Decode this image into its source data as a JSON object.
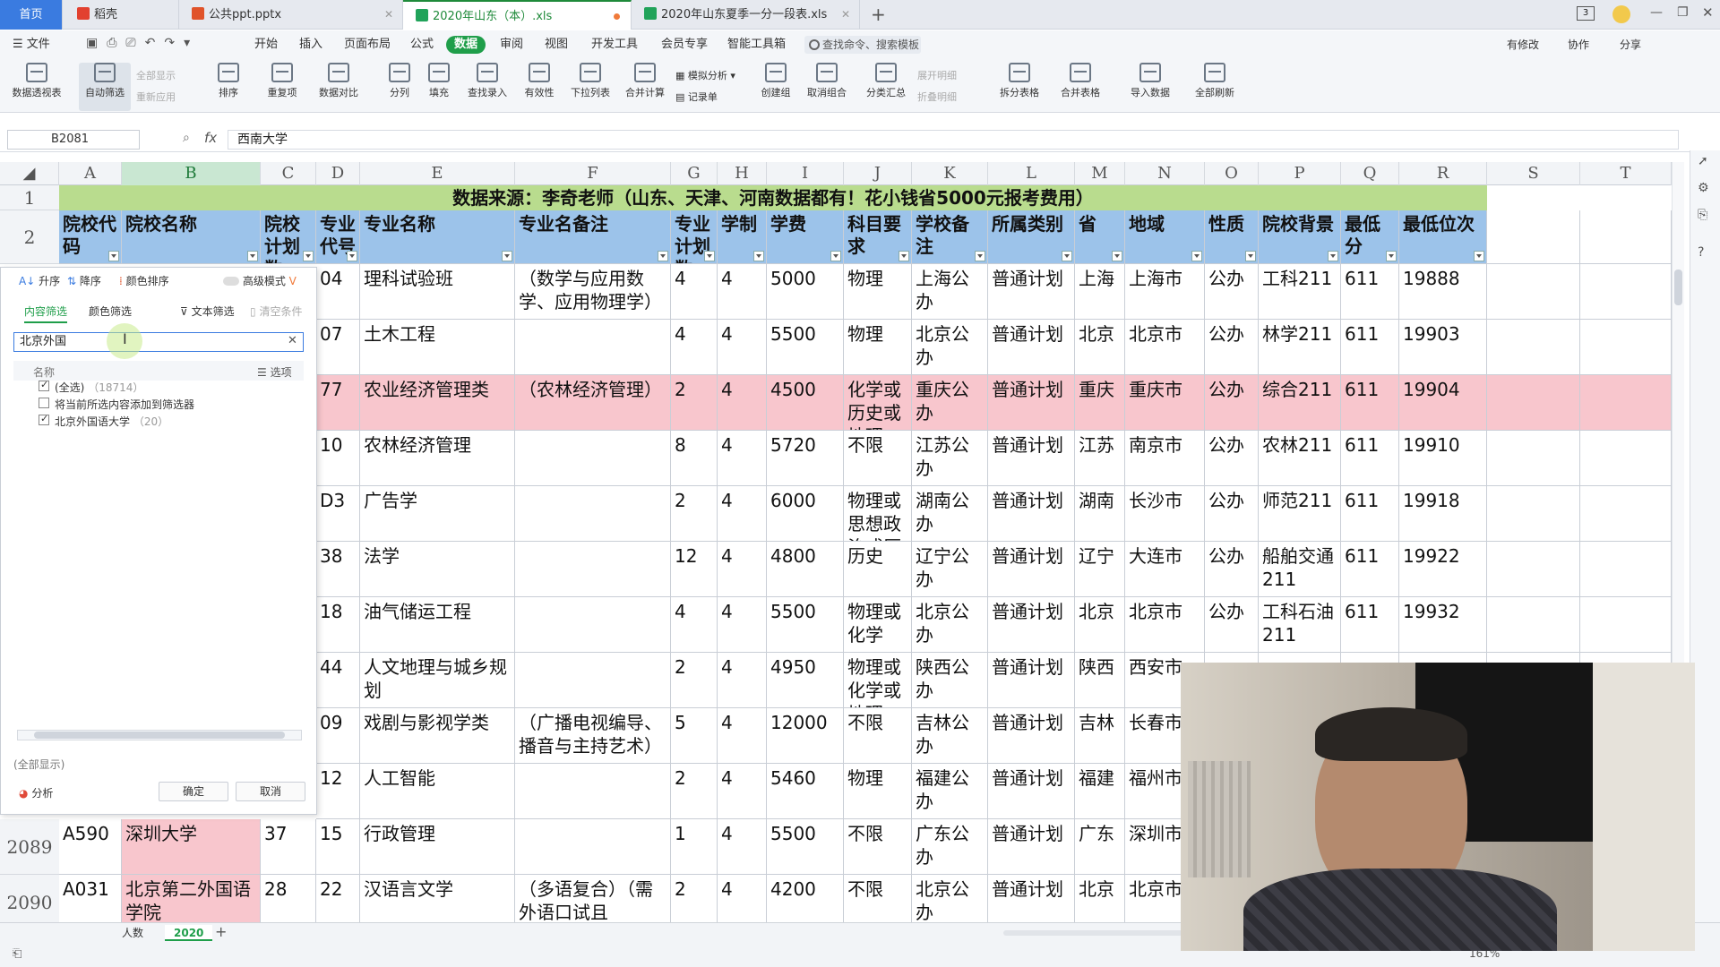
{
  "tabs": [
    {
      "label": "首页"
    },
    {
      "label": "稻壳"
    },
    {
      "label": "公共ppt.pptx"
    },
    {
      "label": "2020年山东（本）.xls"
    },
    {
      "label": "2020年山东夏季一分一段表.xls"
    }
  ],
  "menu": {
    "file": "文件",
    "items": [
      "开始",
      "插入",
      "页面布局",
      "公式",
      "数据",
      "审阅",
      "视图",
      "开发工具",
      "会员专享",
      "智能工具箱"
    ],
    "search": "查找命令、搜索模板",
    "right": [
      "有修改",
      "协作",
      "分享"
    ]
  },
  "ribbon": {
    "big": [
      "数据透视表",
      "自动筛选",
      "排序",
      "重复项",
      "数据对比",
      "分列",
      "填充",
      "查找录入",
      "有效性",
      "下拉列表",
      "合并计算",
      "创建组",
      "取消组合",
      "分类汇总",
      "拆分表格",
      "合并表格",
      "导入数据",
      "全部刷新"
    ],
    "small": [
      "全部显示",
      "重新应用",
      "模拟分析",
      "记录单",
      "展开明细",
      "折叠明细"
    ]
  },
  "formula": {
    "cell_ref": "B2081",
    "fx": "fx",
    "content": "西南大学"
  },
  "columns": [
    "A",
    "B",
    "C",
    "D",
    "E",
    "F",
    "G",
    "H",
    "I",
    "J",
    "K",
    "L",
    "M",
    "N",
    "O",
    "P",
    "Q",
    "R",
    "S",
    "T"
  ],
  "title_row": "数据来源：李奇老师（山东、天津、河南数据都有！花小钱省5000元报考费用）",
  "headers": [
    "院校代码",
    "院校名称",
    "院校计划数",
    "专业代号",
    "专业名称",
    "专业名备注",
    "专业计划数",
    "学制",
    "学费",
    "科目要求",
    "学校备注",
    "所属类别",
    "省",
    "地域",
    "性质",
    "院校背景",
    "最低分",
    "最低位次"
  ],
  "rows": [
    {
      "d": "04",
      "e": "理科试验班",
      "f": "（数学与应用数学、应用物理学）",
      "g": "4",
      "h": "4",
      "i": "5000",
      "j": "物理",
      "k": "上海公办",
      "l": "普通计划",
      "m": "上海",
      "n": "上海市",
      "o": "公办",
      "p": "工科211",
      "q": "611",
      "r": "19888"
    },
    {
      "d": "07",
      "e": "土木工程",
      "f": "",
      "g": "4",
      "h": "4",
      "i": "5500",
      "j": "物理",
      "k": "北京公办",
      "l": "普通计划",
      "m": "北京",
      "n": "北京市",
      "o": "公办",
      "p": "林学211",
      "q": "611",
      "r": "19903"
    },
    {
      "d": "77",
      "e": "农业经济管理类",
      "f": "（农林经济管理）",
      "g": "2",
      "h": "4",
      "i": "4500",
      "j": "化学或历史或地理",
      "k": "重庆公办",
      "l": "普通计划",
      "m": "重庆",
      "n": "重庆市",
      "o": "公办",
      "p": "综合211",
      "q": "611",
      "r": "19904"
    },
    {
      "d": "10",
      "e": "农林经济管理",
      "f": "",
      "g": "8",
      "h": "4",
      "i": "5720",
      "j": "不限",
      "k": "江苏公办",
      "l": "普通计划",
      "m": "江苏",
      "n": "南京市",
      "o": "公办",
      "p": "农林211",
      "q": "611",
      "r": "19910"
    },
    {
      "d": "D3",
      "e": "广告学",
      "f": "",
      "g": "2",
      "h": "4",
      "i": "6000",
      "j": "物理或思想政治或历史",
      "k": "湖南公办",
      "l": "普通计划",
      "m": "湖南",
      "n": "长沙市",
      "o": "公办",
      "p": "师范211",
      "q": "611",
      "r": "19918"
    },
    {
      "d": "38",
      "e": "法学",
      "f": "",
      "g": "12",
      "h": "4",
      "i": "4800",
      "j": "历史",
      "k": "辽宁公办",
      "l": "普通计划",
      "m": "辽宁",
      "n": "大连市",
      "o": "公办",
      "p": "船舶交通211",
      "q": "611",
      "r": "19922"
    },
    {
      "d": "18",
      "e": "油气储运工程",
      "f": "",
      "g": "4",
      "h": "4",
      "i": "5500",
      "j": "物理或化学",
      "k": "北京公办",
      "l": "普通计划",
      "m": "北京",
      "n": "北京市",
      "o": "公办",
      "p": "工科石油211",
      "q": "611",
      "r": "19932"
    },
    {
      "d": "44",
      "e": "人文地理与城乡规划",
      "f": "",
      "g": "2",
      "h": "4",
      "i": "4950",
      "j": "物理或化学或地理",
      "k": "陕西公办",
      "l": "普通计划",
      "m": "陕西",
      "n": "西安市",
      "o": "",
      "p": "",
      "q": "",
      "r": ""
    },
    {
      "d": "09",
      "e": "戏剧与影视学类",
      "f": "（广播电视编导、播音与主持艺术）",
      "g": "5",
      "h": "4",
      "i": "12000",
      "j": "不限",
      "k": "吉林公办",
      "l": "普通计划",
      "m": "吉林",
      "n": "长春市",
      "o": "",
      "p": "",
      "q": "",
      "r": ""
    },
    {
      "d": "12",
      "e": "人工智能",
      "f": "",
      "g": "2",
      "h": "4",
      "i": "5460",
      "j": "物理",
      "k": "福建公办",
      "l": "普通计划",
      "m": "福建",
      "n": "福州市",
      "o": "",
      "p": "",
      "q": "",
      "r": ""
    },
    {
      "rownum": "2089",
      "a": "A590",
      "b": "深圳大学",
      "c": "37",
      "d": "15",
      "e": "行政管理",
      "f": "",
      "g": "1",
      "h": "4",
      "i": "5500",
      "j": "不限",
      "k": "广东公办",
      "l": "普通计划",
      "m": "广东",
      "n": "深圳市",
      "o": "",
      "p": "",
      "q": "",
      "r": ""
    },
    {
      "rownum": "2090",
      "a": "A031",
      "b": "北京第二外国语学院",
      "c": "28",
      "d": "22",
      "e": "汉语言文学",
      "f": "（多语复合）（需外语口试且",
      "g": "2",
      "h": "4",
      "i": "4200",
      "j": "不限",
      "k": "北京公办",
      "l": "普通计划",
      "m": "北京",
      "n": "北京市",
      "o": "",
      "p": "",
      "q": "",
      "r": ""
    }
  ],
  "filter_panel": {
    "sort_asc": "升序",
    "sort_desc": "降序",
    "sort_color": "颜色排序",
    "advanced": "高级模式",
    "tab_content": "内容筛选",
    "tab_color": "颜色筛选",
    "tab_text": "文本筛选",
    "tab_clear": "清空条件",
    "search_value": "北京外国",
    "list_header": "名称",
    "options": "选项",
    "items": [
      {
        "label": "(全选)",
        "count": "（18714）",
        "checked": true
      },
      {
        "label": "将当前所选内容添加到筛选器",
        "count": "",
        "checked": false
      },
      {
        "label": "北京外国语大学",
        "count": "（20）",
        "checked": true
      }
    ],
    "show_all": "(全部显示)",
    "analyze": "分析",
    "ok": "确定",
    "cancel": "取消"
  },
  "sheets": [
    "人数",
    "2020"
  ],
  "zoom": "161%"
}
